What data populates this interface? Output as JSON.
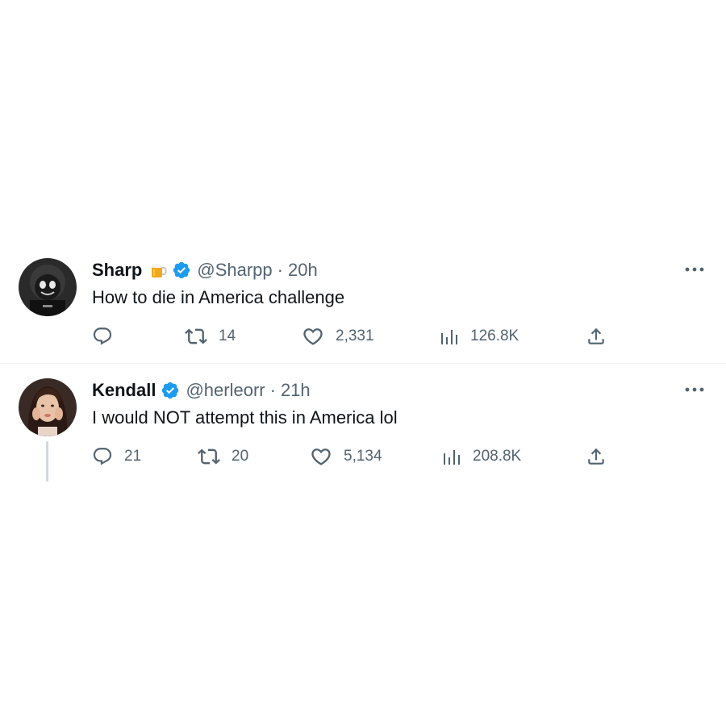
{
  "tweets": [
    {
      "display_name": "Sharp",
      "name_emoji_icon": "beer-mug-icon",
      "verified_icon": "verified-badge-icon",
      "handle": "@Sharpp",
      "separator": "·",
      "time": "20h",
      "text": "How to die in America challenge",
      "more_icon": "more-options-icon",
      "actions": {
        "reply": {
          "icon": "reply-icon",
          "count": ""
        },
        "retweet": {
          "icon": "retweet-icon",
          "count": "14"
        },
        "like": {
          "icon": "heart-icon",
          "count": "2,331"
        },
        "views": {
          "icon": "views-icon",
          "count": "126.8K"
        },
        "share": {
          "icon": "share-icon"
        }
      }
    },
    {
      "display_name": "Kendall",
      "verified_icon": "verified-badge-icon",
      "handle": "@herleorr",
      "separator": "·",
      "time": "21h",
      "text": "I would NOT attempt this in America lol",
      "more_icon": "more-options-icon",
      "actions": {
        "reply": {
          "icon": "reply-icon",
          "count": "21"
        },
        "retweet": {
          "icon": "retweet-icon",
          "count": "20"
        },
        "like": {
          "icon": "heart-icon",
          "count": "5,134"
        },
        "views": {
          "icon": "views-icon",
          "count": "208.8K"
        },
        "share": {
          "icon": "share-icon"
        }
      }
    }
  ],
  "colors": {
    "text_primary": "#0f1419",
    "text_secondary": "#536471",
    "verified_blue": "#1d9bf0",
    "divider": "#eff3f4",
    "thread_line": "#cfd9de"
  }
}
